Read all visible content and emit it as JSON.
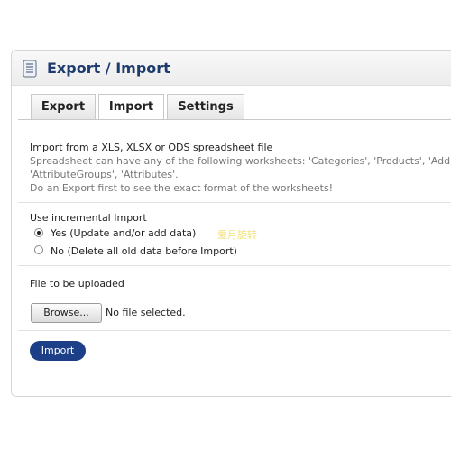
{
  "header": {
    "title": "Export / Import",
    "icon": "document-sheet-icon"
  },
  "tabs": [
    {
      "label": "Export",
      "active": false
    },
    {
      "label": "Import",
      "active": true
    },
    {
      "label": "Settings",
      "active": false
    }
  ],
  "import_section": {
    "heading": "Import from a XLS, XLSX or ODS spreadsheet file",
    "hint_line1": "Spreadsheet can have any of the following worksheets: 'Categories', 'Products', 'Add",
    "hint_line2": "'AttributeGroups', 'Attributes'.",
    "hint_line3": "Do an Export first to see the exact format of the worksheets!"
  },
  "incremental": {
    "label": "Use incremental Import",
    "options": [
      {
        "label": "Yes (Update and/or add data)",
        "checked": true
      },
      {
        "label": "No (Delete all old data before Import)",
        "checked": false
      }
    ],
    "watermark": "爱月旋转"
  },
  "file_upload": {
    "label": "File to be uploaded",
    "browse_label": "Browse...",
    "status": "No file selected."
  },
  "actions": {
    "import_label": "Import"
  },
  "colors": {
    "title": "#1e3b6e",
    "button": "#1c3f87",
    "hint": "#777777"
  }
}
